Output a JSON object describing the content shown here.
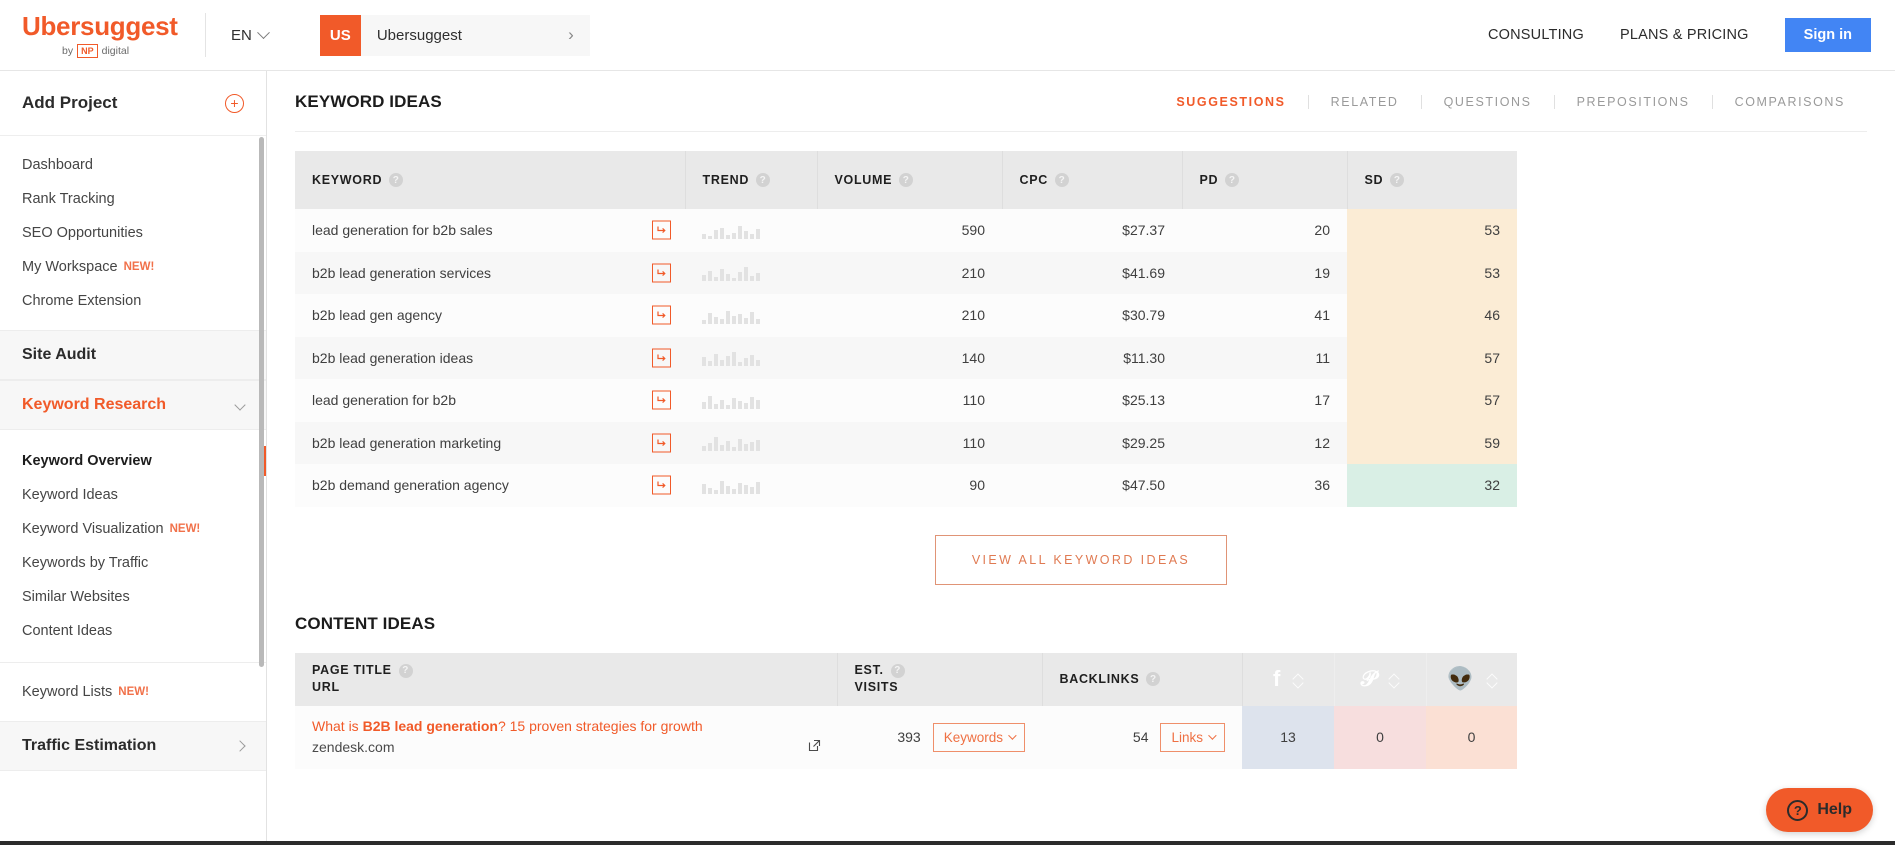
{
  "topbar": {
    "brand_name": "Ubersuggest",
    "brand_by": "by",
    "brand_np": "NP",
    "brand_digital": "digital",
    "language": "EN",
    "project_avatar": "US",
    "project_name": "Ubersuggest",
    "nav": [
      {
        "label": "CONSULTING",
        "name": "consulting"
      },
      {
        "label": "PLANS & PRICING",
        "name": "plans-pricing"
      }
    ],
    "signin_label": "Sign in",
    "signin_color": "#4285f4"
  },
  "sidebar": {
    "add_project": "Add Project",
    "primary": [
      {
        "label": "Dashboard"
      },
      {
        "label": "Rank Tracking"
      },
      {
        "label": "SEO Opportunities"
      },
      {
        "label": "My Workspace",
        "badge": "NEW!"
      },
      {
        "label": "Chrome Extension"
      }
    ],
    "site_audit": "Site Audit",
    "keyword_research": "Keyword Research",
    "keyword_sub": [
      {
        "label": "Keyword Overview",
        "current": true
      },
      {
        "label": "Keyword Ideas"
      },
      {
        "label": "Keyword Visualization",
        "badge": "NEW!"
      },
      {
        "label": "Keywords by Traffic"
      },
      {
        "label": "Similar Websites"
      },
      {
        "label": "Content Ideas"
      }
    ],
    "keyword_lists": "Keyword Lists",
    "keyword_lists_badge": "NEW!",
    "traffic_estimation": "Traffic Estimation",
    "accent": "#f15a29"
  },
  "keyword_ideas": {
    "title": "KEYWORD IDEAS",
    "tabs": [
      {
        "label": "SUGGESTIONS",
        "active": true
      },
      {
        "label": "RELATED",
        "active": false
      },
      {
        "label": "QUESTIONS",
        "active": false
      },
      {
        "label": "PREPOSITIONS",
        "active": false
      },
      {
        "label": "COMPARISONS",
        "active": false
      }
    ],
    "columns": [
      "KEYWORD",
      "TREND",
      "VOLUME",
      "CPC",
      "PD",
      "SD"
    ],
    "rows": [
      {
        "keyword": "lead generation for b2b sales",
        "volume": "590",
        "cpc": "$27.37",
        "pd": "20",
        "sd": "53",
        "sd_tone": "warm",
        "spark": [
          5,
          3,
          9,
          11,
          4,
          6,
          13,
          8,
          5,
          10
        ]
      },
      {
        "keyword": "b2b lead generation services",
        "volume": "210",
        "cpc": "$41.69",
        "pd": "19",
        "sd": "53",
        "sd_tone": "warm",
        "spark": [
          6,
          10,
          4,
          12,
          7,
          3,
          9,
          14,
          5,
          8
        ]
      },
      {
        "keyword": "b2b lead gen agency",
        "volume": "210",
        "cpc": "$30.79",
        "pd": "41",
        "sd": "46",
        "sd_tone": "warm",
        "spark": [
          4,
          11,
          7,
          5,
          13,
          8,
          10,
          6,
          12,
          5
        ]
      },
      {
        "keyword": "b2b lead generation ideas",
        "volume": "140",
        "cpc": "$11.30",
        "pd": "11",
        "sd": "57",
        "sd_tone": "warm",
        "spark": [
          9,
          5,
          12,
          6,
          10,
          14,
          4,
          8,
          11,
          6
        ]
      },
      {
        "keyword": "lead generation for b2b",
        "volume": "110",
        "cpc": "$25.13",
        "pd": "17",
        "sd": "57",
        "sd_tone": "warm",
        "spark": [
          7,
          13,
          5,
          9,
          4,
          11,
          8,
          6,
          12,
          9
        ]
      },
      {
        "keyword": "b2b lead generation marketing",
        "volume": "110",
        "cpc": "$29.25",
        "pd": "12",
        "sd": "59",
        "sd_tone": "warm",
        "spark": [
          5,
          8,
          14,
          6,
          10,
          4,
          12,
          7,
          9,
          11
        ]
      },
      {
        "keyword": "b2b demand generation agency",
        "volume": "90",
        "cpc": "$47.50",
        "pd": "36",
        "sd": "32",
        "sd_tone": "cool",
        "spark": [
          10,
          6,
          4,
          13,
          8,
          5,
          11,
          9,
          7,
          12
        ]
      }
    ],
    "view_all_label": "VIEW ALL KEYWORD IDEAS",
    "sd_warm_color": "#fbecd5",
    "sd_cool_color": "#d9efe5"
  },
  "content_ideas": {
    "title": "CONTENT IDEAS",
    "columns": {
      "page_title": "PAGE TITLE",
      "url": "URL",
      "est": "EST.",
      "visits": "VISITS",
      "backlinks": "BACKLINKS",
      "facebook": "facebook-icon",
      "pinterest": "pinterest-icon",
      "reddit": "reddit-icon"
    },
    "rows": [
      {
        "title_prefix": "What is ",
        "title_bold": "B2B lead generation",
        "title_suffix": "? 15 proven strategies for growth",
        "url": "zendesk.com",
        "visits": "393",
        "keywords_pill": "Keywords",
        "backlinks": "54",
        "links_pill": "Links",
        "facebook": "13",
        "pinterest": "0",
        "reddit": "0"
      }
    ],
    "fb_color": "#3b5998",
    "pin_color": "#d32029",
    "reddit_color": "#ff4500"
  },
  "help": {
    "label": "Help",
    "icon": "question-circle-icon",
    "color": "#f15a29"
  }
}
